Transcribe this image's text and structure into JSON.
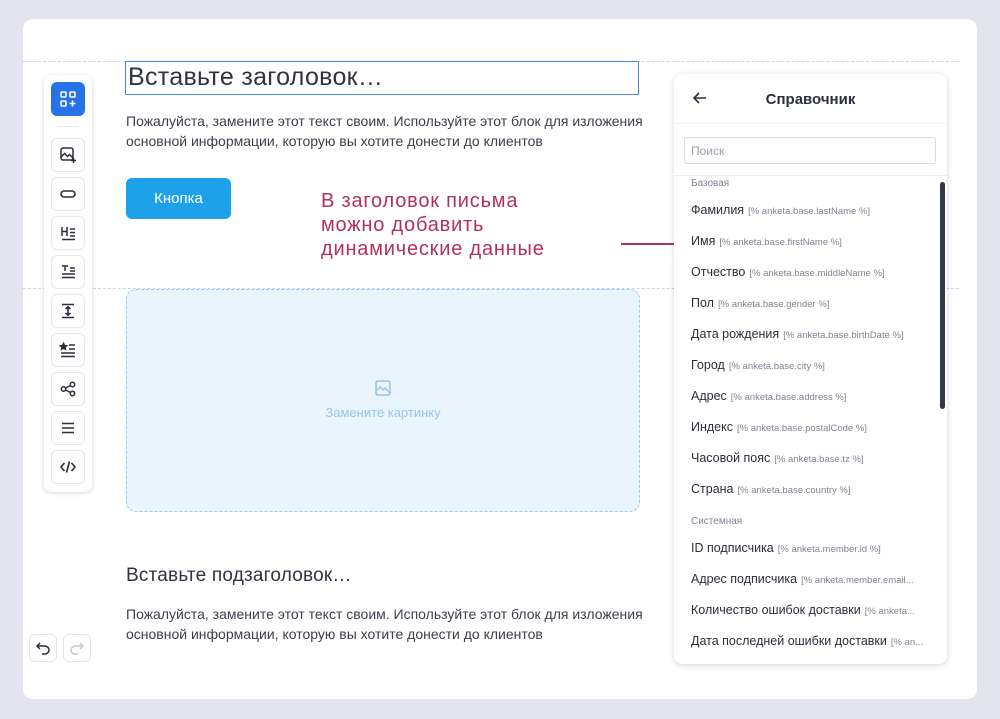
{
  "editor": {
    "title": "Вставьте заголовок…",
    "paragraph": "Пожалуйста, замените этот текст своим. Используйте этот блок для изложения основной информации, которую вы хотите донести до клиентов",
    "button_label": "Кнопка",
    "image_placeholder": "Замените картинку",
    "subtitle": "Вставьте подзаголовок…",
    "paragraph2": "Пожалуйста, замените этот текст своим. Используйте этот блок для изложения основной информации, которую вы хотите донести до клиентов"
  },
  "annotation": {
    "line1": "В заголовок письма",
    "line2": "можно добавить",
    "line3": "динамические данные",
    "color": "#b3305e"
  },
  "toolbar": {
    "items": [
      "blocks-icon",
      "image-add-icon",
      "link-icon",
      "heading-icon",
      "text-icon",
      "spacer-icon",
      "list-icon",
      "share-icon",
      "menu-icon",
      "code-icon"
    ]
  },
  "panel": {
    "title": "Справочник",
    "search_placeholder": "Поиск",
    "sections": [
      {
        "label": "Базовая",
        "items": [
          {
            "name": "Фамилия",
            "code": "[% anketa.base.lastName %]"
          },
          {
            "name": "Имя",
            "code": "[% anketa.base.firstName %]"
          },
          {
            "name": "Отчество",
            "code": "[% anketa.base.middleName %]"
          },
          {
            "name": "Пол",
            "code": "[% anketa.base.gender %]"
          },
          {
            "name": "Дата рождения",
            "code": "[% anketa.base.birthDate %]"
          },
          {
            "name": "Город",
            "code": "[% anketa.base.city %]"
          },
          {
            "name": "Адрес",
            "code": "[% anketa.base.address %]"
          },
          {
            "name": "Индекс",
            "code": "[% anketa.base.postalCode %]"
          },
          {
            "name": "Часовой пояс",
            "code": "[% anketa.base.tz %]"
          },
          {
            "name": "Страна",
            "code": "[% anketa.base.country %]"
          }
        ]
      },
      {
        "label": "Системная",
        "items": [
          {
            "name": "ID подписчика",
            "code": "[% anketa.member.id %]"
          },
          {
            "name": "Адрес подписчика",
            "code": "[% anketa.member.email..."
          },
          {
            "name": "Количество ошибок доставки",
            "code": "[% anketa..."
          },
          {
            "name": "Дата последней ошибки доставки",
            "code": "[% an..."
          }
        ]
      }
    ]
  },
  "colors": {
    "accent": "#2672e8",
    "button": "#1da1e8",
    "background": "#e3e4f0"
  }
}
